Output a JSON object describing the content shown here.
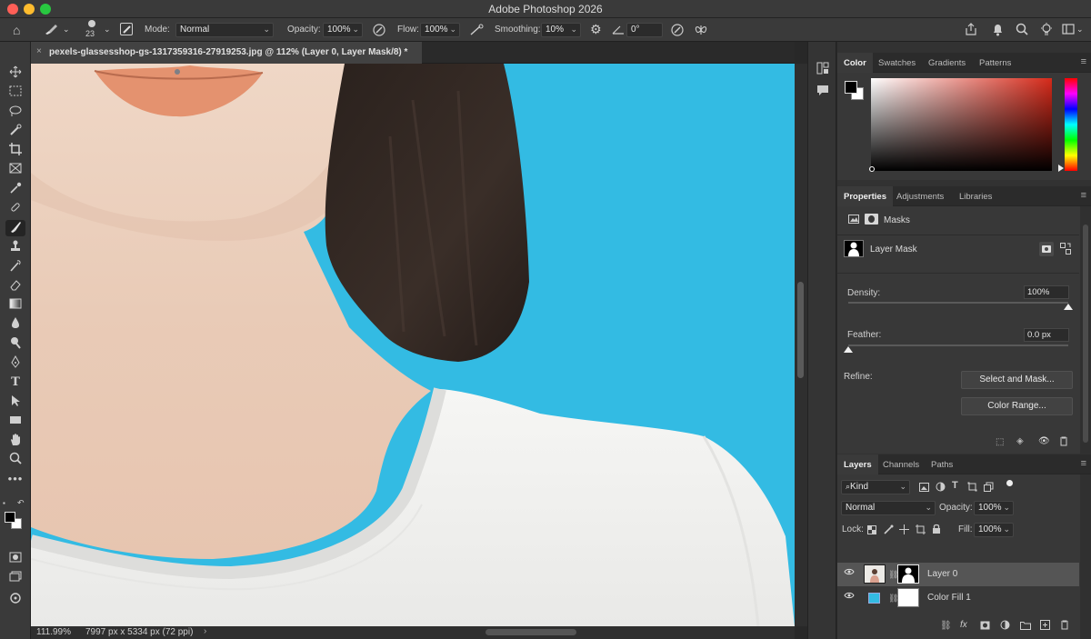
{
  "app": {
    "title": "Adobe Photoshop 2026"
  },
  "colors": {
    "canvas_bg": "#33bbe3",
    "panel_bg": "#383838",
    "chrome": "#3a3a3a",
    "accent_red": "#d62a1a"
  },
  "options": {
    "brush_size": "23",
    "mode_label": "Mode:",
    "mode_value": "Normal",
    "opacity_label": "Opacity:",
    "opacity_value": "100%",
    "flow_label": "Flow:",
    "flow_value": "100%",
    "smoothing_label": "Smoothing:",
    "smoothing_value": "10%",
    "angle_value": "0°"
  },
  "document": {
    "tab_title": "pexels-glassesshop-gs-1317359316-27919253.jpg @ 112% (Layer 0, Layer Mask/8) *",
    "zoom": "111.99%",
    "doc_info": "7997 px x 5334 px (72 ppi)"
  },
  "tools": [
    "move-icon",
    "marquee-icon",
    "lasso-icon",
    "quick-select-icon",
    "crop-icon",
    "frame-icon",
    "eyedropper-icon",
    "healing-icon",
    "brush-icon",
    "stamp-icon",
    "history-brush-icon",
    "eraser-icon",
    "gradient-icon",
    "blur-icon",
    "dodge-icon",
    "pen-icon",
    "type-icon",
    "path-select-icon",
    "rectangle-icon",
    "hand-icon",
    "zoom-icon",
    "more-icon"
  ],
  "color_panel": {
    "tabs": [
      "Color",
      "Swatches",
      "Gradients",
      "Patterns"
    ]
  },
  "properties_panel": {
    "tabs": [
      "Properties",
      "Adjustments",
      "Libraries"
    ],
    "section_label": "Masks",
    "mask_name": "Layer Mask",
    "density_label": "Density:",
    "density_value": "100%",
    "density_level": 1.0,
    "feather_label": "Feather:",
    "feather_value": "0.0 px",
    "feather_level": 0.0,
    "refine_label": "Refine:",
    "select_mask_button": "Select and Mask...",
    "color_range_button": "Color Range..."
  },
  "layers_panel": {
    "tabs": [
      "Layers",
      "Channels",
      "Paths"
    ],
    "filter_kind": "Kind",
    "blend_mode": "Normal",
    "opacity_label": "Opacity:",
    "opacity_value": "100%",
    "lock_label": "Lock:",
    "fill_label": "Fill:",
    "fill_value": "100%",
    "layers": [
      {
        "name": "Layer 0",
        "selected": true
      },
      {
        "name": "Color Fill 1",
        "selected": false
      }
    ]
  }
}
